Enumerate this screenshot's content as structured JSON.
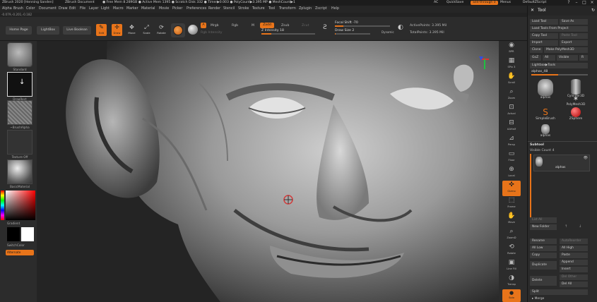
{
  "titlebar": {
    "app": "ZBrush 2020 [Henning Sanden]",
    "doc": "ZBrush Document",
    "mem": "● Free Mem 8.289GB ● Active Mem 1395 ● Scratch Disk 332 ● Timer▶0.003 ● PolyCount▶3.395 MP ● MeshCount▶1",
    "ac": "AC",
    "quicksave": "QuickSave",
    "seethrough": "See-through 0",
    "menus": "Menus",
    "script": "DefaultZScript"
  },
  "menu": [
    "Alpha",
    "Brush",
    "Color",
    "Document",
    "Draw",
    "Edit",
    "File",
    "Layer",
    "Light",
    "Macro",
    "Marker",
    "Material",
    "Movie",
    "Picker",
    "Preferences",
    "Render",
    "Stencil",
    "Stroke",
    "Texture",
    "Tool",
    "Transform",
    "Zplugin",
    "Zscript",
    "Help"
  ],
  "coords": "-0.079,-0.201,-0.182",
  "shelf": {
    "home": "Home Page",
    "lightbox": "LightBox",
    "liveboolean": "Live Boolean",
    "tools": [
      "Edit",
      "Draw",
      "Move",
      "Scale",
      "Rotate"
    ],
    "a": "A",
    "mrgb": "Mrgb",
    "rgb": "Rgb",
    "m": "M",
    "zadd": "Zadd",
    "zsub": "Zsub",
    "zcut": "Zcut",
    "rgb_intensity": "Rgb Intensity",
    "z_intensity": "Z Intensity 18",
    "z_intensity_value": 0.18,
    "focal_shift": "Focal Shift -70",
    "focal_value": 0.15,
    "draw_size": "Draw Size 2",
    "draw_value": 0.02,
    "dynamic": "Dynamic",
    "active_points": "ActivePoints: 3.395 Mil",
    "total_points": "TotalPoints: 3.395 Mil"
  },
  "left": {
    "standard": "Standard",
    "dragrect": "DragRect",
    "brushalpha": "~BrushAlpha",
    "texture": "Texture Off",
    "material": "BasicMaterial",
    "gradient": "Gradient",
    "switchcolor": "SwitchColor",
    "alternate": "Alternate"
  },
  "right": [
    "BPR",
    "SPix 3",
    "Scroll",
    "Zoom",
    "Actual",
    "AAHalf",
    "Persp",
    "Floor",
    "Local",
    "Gizmo",
    "Frame",
    "Move",
    "ZoomD",
    "Rotate",
    "Line Fill",
    "Transp",
    "Solo"
  ],
  "panel": {
    "title": "Tool",
    "load_tool": "Load Tool",
    "save_as": "Save As",
    "load_from_project": "Load Tools From Project",
    "copy_tool": "Copy Tool",
    "paste_tool": "Paste Tool",
    "import": "Import",
    "export": "Export",
    "clone": "Clone",
    "make_polymesh": "Make PolyMesh3D",
    "goz": "GoZ",
    "all": "All",
    "visible": "Visible",
    "r": "R",
    "lightbox_tools": "Lightbox▶Tools",
    "alphas_48": "alphas_48",
    "alphas_value": 0.48,
    "thumbs": [
      "alphas",
      "Cylinder3D",
      "PolyMesh3D",
      "SimpleBrush",
      "ZSphere",
      "alphas"
    ],
    "subtool": "Subtool",
    "visible_count": "Visible Count 4",
    "subtool_item": "alphas",
    "list_all": "List All",
    "new_folder": "New Folder",
    "rename": "Rename",
    "autoreorder": "AutoReorder",
    "all_low": "All Low",
    "all_high": "All High",
    "copy": "Copy",
    "paste": "Paste",
    "duplicate": "Duplicate",
    "append": "Append",
    "insert": "Insert",
    "delete": "Delete",
    "del_other": "Del Other",
    "del_all": "Del All",
    "split": "Split",
    "merge": "▸ Merge"
  },
  "colors": {
    "accent": "#e8741a",
    "panel": "#2a2a2a",
    "canvas": "#242424"
  }
}
